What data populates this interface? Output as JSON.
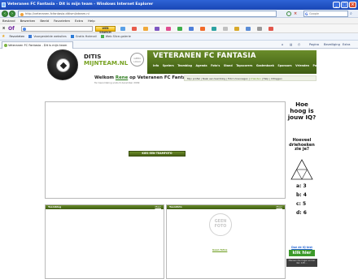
{
  "window": {
    "title": "Veteranen FC Fantasia - Dit is mijn team - Windows Internet Explorer",
    "min_label": "_",
    "max_label": "□",
    "close_label": "×"
  },
  "address_bar": {
    "back_icon": "back-arrow-icon",
    "forward_icon": "forward-arrow-icon",
    "url": "http://veteranen-fcfantasia.ditismijnteam.nl",
    "search_placeholder": "Google",
    "search_engine": "G"
  },
  "menu": [
    "Bestand",
    "Bewerken",
    "Beeld",
    "Favorieten",
    "Extra",
    "Help"
  ],
  "toolbar": {
    "close_glyph": "x",
    "logo_text": "Of",
    "search_button": "WEB SEARCH"
  },
  "favorites_bar": {
    "favorites_label": "Favorieten",
    "suggested_sites": "Voorgestelde websites",
    "hotmail": "Gratis Hotmail",
    "web_slice": "Web Slice-galerie"
  },
  "tab": {
    "label": "Veteranen FC Fantasia - Dit is mijn team"
  },
  "command_bar": {
    "page": "Pagina",
    "safety": "Beveiliging",
    "extra": "Extra"
  },
  "site": {
    "brand_line1": "DITIS",
    "brand_line2": "MIJNTEAM.NL",
    "seal_text": "GEEN LOGO",
    "team_name": "VETERANEN FC FANTASIA",
    "nav": [
      "Info",
      "Spelers",
      "Teamblog",
      "Agenda",
      "Foto's",
      "Stand",
      "Topscorers",
      "Gastenboek",
      "Sponsors",
      "Vrienden",
      "Poll"
    ],
    "welcome_prefix": "Welkom",
    "welcome_user": "Rene",
    "welcome_suffix": "op Veteranen FC Fantasia",
    "member_since": "Ter beoordeling sinds 6 december 2009",
    "user_links": [
      "Mijn profiel",
      "Naak een teamblog",
      "Foto's toevoegen",
      "Vrienden",
      "Help",
      "Uitloggen"
    ],
    "user_links_active_index": 3,
    "photo_button": "KIES EEN TEAMFOTO"
  },
  "ad": {
    "question": "Hoe hoog is jouw IQ?",
    "sub": "Hoeveel driehoeken zie je?",
    "answers": [
      "a: 3",
      "b: 4",
      "c: 5",
      "d: 6"
    ],
    "link": "Doe de IQ test",
    "button": "klik hier",
    "footer": "Mensen die hoger scoren dan 128 ..."
  },
  "boxes": {
    "teamblog": {
      "title": "Teamblog",
      "more": "Meer"
    },
    "teamfoto": {
      "title": "Teamfoto",
      "more": "Meer"
    },
    "photo_placeholder": "GEEN FOTO",
    "caption": "Geen fotos"
  },
  "colors": {
    "accent_green": "#6a8c2a",
    "titlebar_blue": "#2e63d6"
  }
}
